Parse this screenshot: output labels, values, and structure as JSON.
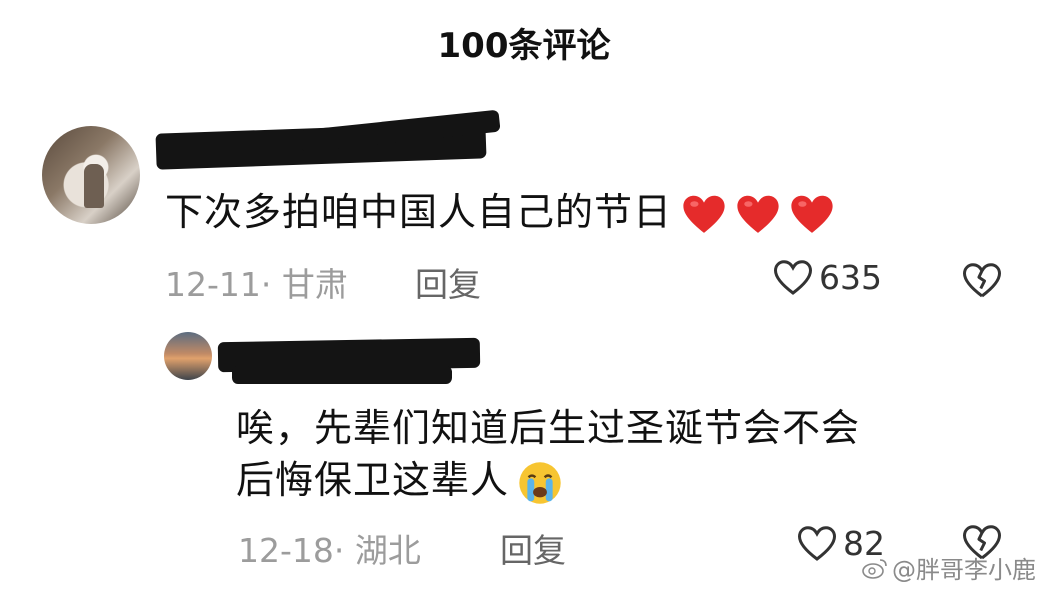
{
  "header": {
    "title": "100条评论"
  },
  "comments": [
    {
      "text": "下次多拍咱中国人自己的节日",
      "date": "12-11",
      "location": "甘肃",
      "reply_label": "回复",
      "likes": "635",
      "emojis": [
        "red-heart",
        "red-heart",
        "red-heart"
      ]
    },
    {
      "text_line1": "唉，先辈们知道后生过圣诞节会不会",
      "text_line2": "后悔保卫这辈人",
      "date": "12-18",
      "location": "湖北",
      "reply_label": "回复",
      "likes": "82",
      "emojis": [
        "crying-face"
      ]
    }
  ],
  "watermark": {
    "text": "@胖哥李小鹿"
  },
  "colors": {
    "heart": "#e52b2b",
    "meta": "#9c9c9c"
  }
}
